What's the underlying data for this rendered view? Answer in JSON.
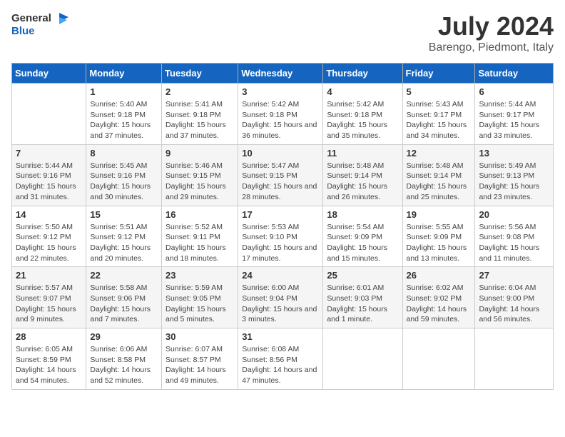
{
  "logo": {
    "text_general": "General",
    "text_blue": "Blue"
  },
  "header": {
    "title": "July 2024",
    "subtitle": "Barengo, Piedmont, Italy"
  },
  "days_of_week": [
    "Sunday",
    "Monday",
    "Tuesday",
    "Wednesday",
    "Thursday",
    "Friday",
    "Saturday"
  ],
  "weeks": [
    [
      {
        "day": "",
        "sunrise": "",
        "sunset": "",
        "daylight": ""
      },
      {
        "day": "1",
        "sunrise": "Sunrise: 5:40 AM",
        "sunset": "Sunset: 9:18 PM",
        "daylight": "Daylight: 15 hours and 37 minutes."
      },
      {
        "day": "2",
        "sunrise": "Sunrise: 5:41 AM",
        "sunset": "Sunset: 9:18 PM",
        "daylight": "Daylight: 15 hours and 37 minutes."
      },
      {
        "day": "3",
        "sunrise": "Sunrise: 5:42 AM",
        "sunset": "Sunset: 9:18 PM",
        "daylight": "Daylight: 15 hours and 36 minutes."
      },
      {
        "day": "4",
        "sunrise": "Sunrise: 5:42 AM",
        "sunset": "Sunset: 9:18 PM",
        "daylight": "Daylight: 15 hours and 35 minutes."
      },
      {
        "day": "5",
        "sunrise": "Sunrise: 5:43 AM",
        "sunset": "Sunset: 9:17 PM",
        "daylight": "Daylight: 15 hours and 34 minutes."
      },
      {
        "day": "6",
        "sunrise": "Sunrise: 5:44 AM",
        "sunset": "Sunset: 9:17 PM",
        "daylight": "Daylight: 15 hours and 33 minutes."
      }
    ],
    [
      {
        "day": "7",
        "sunrise": "Sunrise: 5:44 AM",
        "sunset": "Sunset: 9:16 PM",
        "daylight": "Daylight: 15 hours and 31 minutes."
      },
      {
        "day": "8",
        "sunrise": "Sunrise: 5:45 AM",
        "sunset": "Sunset: 9:16 PM",
        "daylight": "Daylight: 15 hours and 30 minutes."
      },
      {
        "day": "9",
        "sunrise": "Sunrise: 5:46 AM",
        "sunset": "Sunset: 9:15 PM",
        "daylight": "Daylight: 15 hours and 29 minutes."
      },
      {
        "day": "10",
        "sunrise": "Sunrise: 5:47 AM",
        "sunset": "Sunset: 9:15 PM",
        "daylight": "Daylight: 15 hours and 28 minutes."
      },
      {
        "day": "11",
        "sunrise": "Sunrise: 5:48 AM",
        "sunset": "Sunset: 9:14 PM",
        "daylight": "Daylight: 15 hours and 26 minutes."
      },
      {
        "day": "12",
        "sunrise": "Sunrise: 5:48 AM",
        "sunset": "Sunset: 9:14 PM",
        "daylight": "Daylight: 15 hours and 25 minutes."
      },
      {
        "day": "13",
        "sunrise": "Sunrise: 5:49 AM",
        "sunset": "Sunset: 9:13 PM",
        "daylight": "Daylight: 15 hours and 23 minutes."
      }
    ],
    [
      {
        "day": "14",
        "sunrise": "Sunrise: 5:50 AM",
        "sunset": "Sunset: 9:12 PM",
        "daylight": "Daylight: 15 hours and 22 minutes."
      },
      {
        "day": "15",
        "sunrise": "Sunrise: 5:51 AM",
        "sunset": "Sunset: 9:12 PM",
        "daylight": "Daylight: 15 hours and 20 minutes."
      },
      {
        "day": "16",
        "sunrise": "Sunrise: 5:52 AM",
        "sunset": "Sunset: 9:11 PM",
        "daylight": "Daylight: 15 hours and 18 minutes."
      },
      {
        "day": "17",
        "sunrise": "Sunrise: 5:53 AM",
        "sunset": "Sunset: 9:10 PM",
        "daylight": "Daylight: 15 hours and 17 minutes."
      },
      {
        "day": "18",
        "sunrise": "Sunrise: 5:54 AM",
        "sunset": "Sunset: 9:09 PM",
        "daylight": "Daylight: 15 hours and 15 minutes."
      },
      {
        "day": "19",
        "sunrise": "Sunrise: 5:55 AM",
        "sunset": "Sunset: 9:09 PM",
        "daylight": "Daylight: 15 hours and 13 minutes."
      },
      {
        "day": "20",
        "sunrise": "Sunrise: 5:56 AM",
        "sunset": "Sunset: 9:08 PM",
        "daylight": "Daylight: 15 hours and 11 minutes."
      }
    ],
    [
      {
        "day": "21",
        "sunrise": "Sunrise: 5:57 AM",
        "sunset": "Sunset: 9:07 PM",
        "daylight": "Daylight: 15 hours and 9 minutes."
      },
      {
        "day": "22",
        "sunrise": "Sunrise: 5:58 AM",
        "sunset": "Sunset: 9:06 PM",
        "daylight": "Daylight: 15 hours and 7 minutes."
      },
      {
        "day": "23",
        "sunrise": "Sunrise: 5:59 AM",
        "sunset": "Sunset: 9:05 PM",
        "daylight": "Daylight: 15 hours and 5 minutes."
      },
      {
        "day": "24",
        "sunrise": "Sunrise: 6:00 AM",
        "sunset": "Sunset: 9:04 PM",
        "daylight": "Daylight: 15 hours and 3 minutes."
      },
      {
        "day": "25",
        "sunrise": "Sunrise: 6:01 AM",
        "sunset": "Sunset: 9:03 PM",
        "daylight": "Daylight: 15 hours and 1 minute."
      },
      {
        "day": "26",
        "sunrise": "Sunrise: 6:02 AM",
        "sunset": "Sunset: 9:02 PM",
        "daylight": "Daylight: 14 hours and 59 minutes."
      },
      {
        "day": "27",
        "sunrise": "Sunrise: 6:04 AM",
        "sunset": "Sunset: 9:00 PM",
        "daylight": "Daylight: 14 hours and 56 minutes."
      }
    ],
    [
      {
        "day": "28",
        "sunrise": "Sunrise: 6:05 AM",
        "sunset": "Sunset: 8:59 PM",
        "daylight": "Daylight: 14 hours and 54 minutes."
      },
      {
        "day": "29",
        "sunrise": "Sunrise: 6:06 AM",
        "sunset": "Sunset: 8:58 PM",
        "daylight": "Daylight: 14 hours and 52 minutes."
      },
      {
        "day": "30",
        "sunrise": "Sunrise: 6:07 AM",
        "sunset": "Sunset: 8:57 PM",
        "daylight": "Daylight: 14 hours and 49 minutes."
      },
      {
        "day": "31",
        "sunrise": "Sunrise: 6:08 AM",
        "sunset": "Sunset: 8:56 PM",
        "daylight": "Daylight: 14 hours and 47 minutes."
      },
      {
        "day": "",
        "sunrise": "",
        "sunset": "",
        "daylight": ""
      },
      {
        "day": "",
        "sunrise": "",
        "sunset": "",
        "daylight": ""
      },
      {
        "day": "",
        "sunrise": "",
        "sunset": "",
        "daylight": ""
      }
    ]
  ]
}
